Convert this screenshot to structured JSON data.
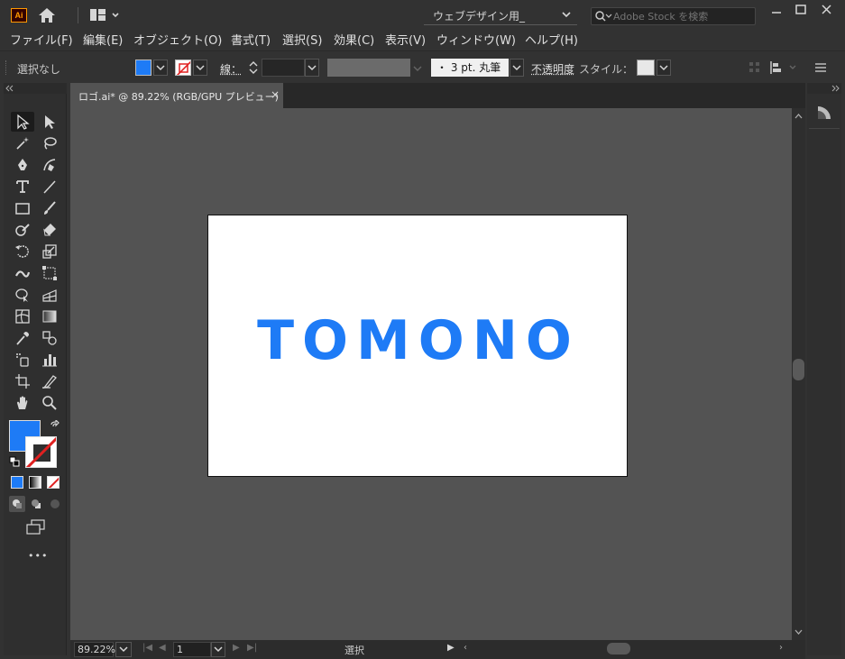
{
  "app": {
    "logo": "Ai",
    "workspace": "ウェブデザイン用_",
    "search_placeholder": "Adobe Stock を検索"
  },
  "menu": [
    "ファイル(F)",
    "編集(E)",
    "オブジェクト(O)",
    "書式(T)",
    "選択(S)",
    "効果(C)",
    "表示(V)",
    "ウィンドウ(W)",
    "ヘルプ(H)"
  ],
  "control": {
    "selection": "選択なし",
    "stroke_label": "線：",
    "brush": "・ 3 pt. 丸筆",
    "opacity_label": "不透明度",
    "style_label": "スタイル：",
    "fill_color": "#1e7bf6"
  },
  "document": {
    "tab_title": "ロゴ.ai* @ 89.22% (RGB/GPU プレビュー)",
    "close_glyph": "×",
    "logo_text": "TOMONO",
    "logo_color": "#1e7bf6"
  },
  "status": {
    "zoom": "89.22%",
    "page": "1",
    "tool": "選択"
  },
  "more_tools": "•••"
}
